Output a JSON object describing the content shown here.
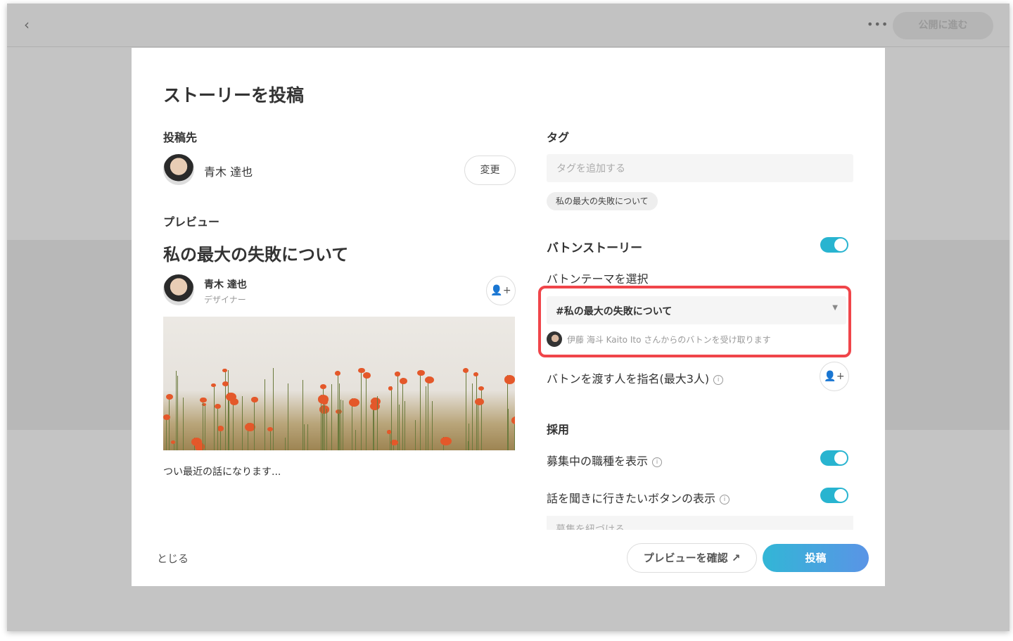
{
  "topbar": {
    "back_icon": "chevron-left-icon",
    "more_icon": "more-dots-icon",
    "publish_label": "公開に進む"
  },
  "modal": {
    "title": "ストーリーを投稿",
    "destination": {
      "label": "投稿先",
      "user_name": "青木 達也",
      "change_label": "変更"
    },
    "preview": {
      "label": "プレビュー",
      "story_title": "私の最大の失敗について",
      "author_name": "青木 達也",
      "author_role": "デザイナー",
      "excerpt": "つい最近の話になります..."
    },
    "tags": {
      "label": "タグ",
      "placeholder": "タグを追加する",
      "chips": [
        "私の最大の失敗について"
      ]
    },
    "baton": {
      "label": "バトンストーリー",
      "enabled": true,
      "theme_label": "バトンテーマを選択",
      "theme_value": "#私の最大の失敗について",
      "receive_note": "伊藤 海斗 Kaito Ito さんからのバトンを受け取ります",
      "nominate_label": "バトンを渡す人を指名(最大3人)"
    },
    "hiring": {
      "label": "採用",
      "show_jobs_label": "募集中の職種を表示",
      "show_jobs": true,
      "show_visit_label": "話を聞きに行きたいボタンの表示",
      "show_visit": true,
      "link_placeholder": "募集を紐づける"
    },
    "footer": {
      "close_label": "とじる",
      "preview_label": "プレビューを確認",
      "post_label": "投稿"
    }
  },
  "colors": {
    "accent": "#28b4d0",
    "highlight": "#f0454a"
  }
}
